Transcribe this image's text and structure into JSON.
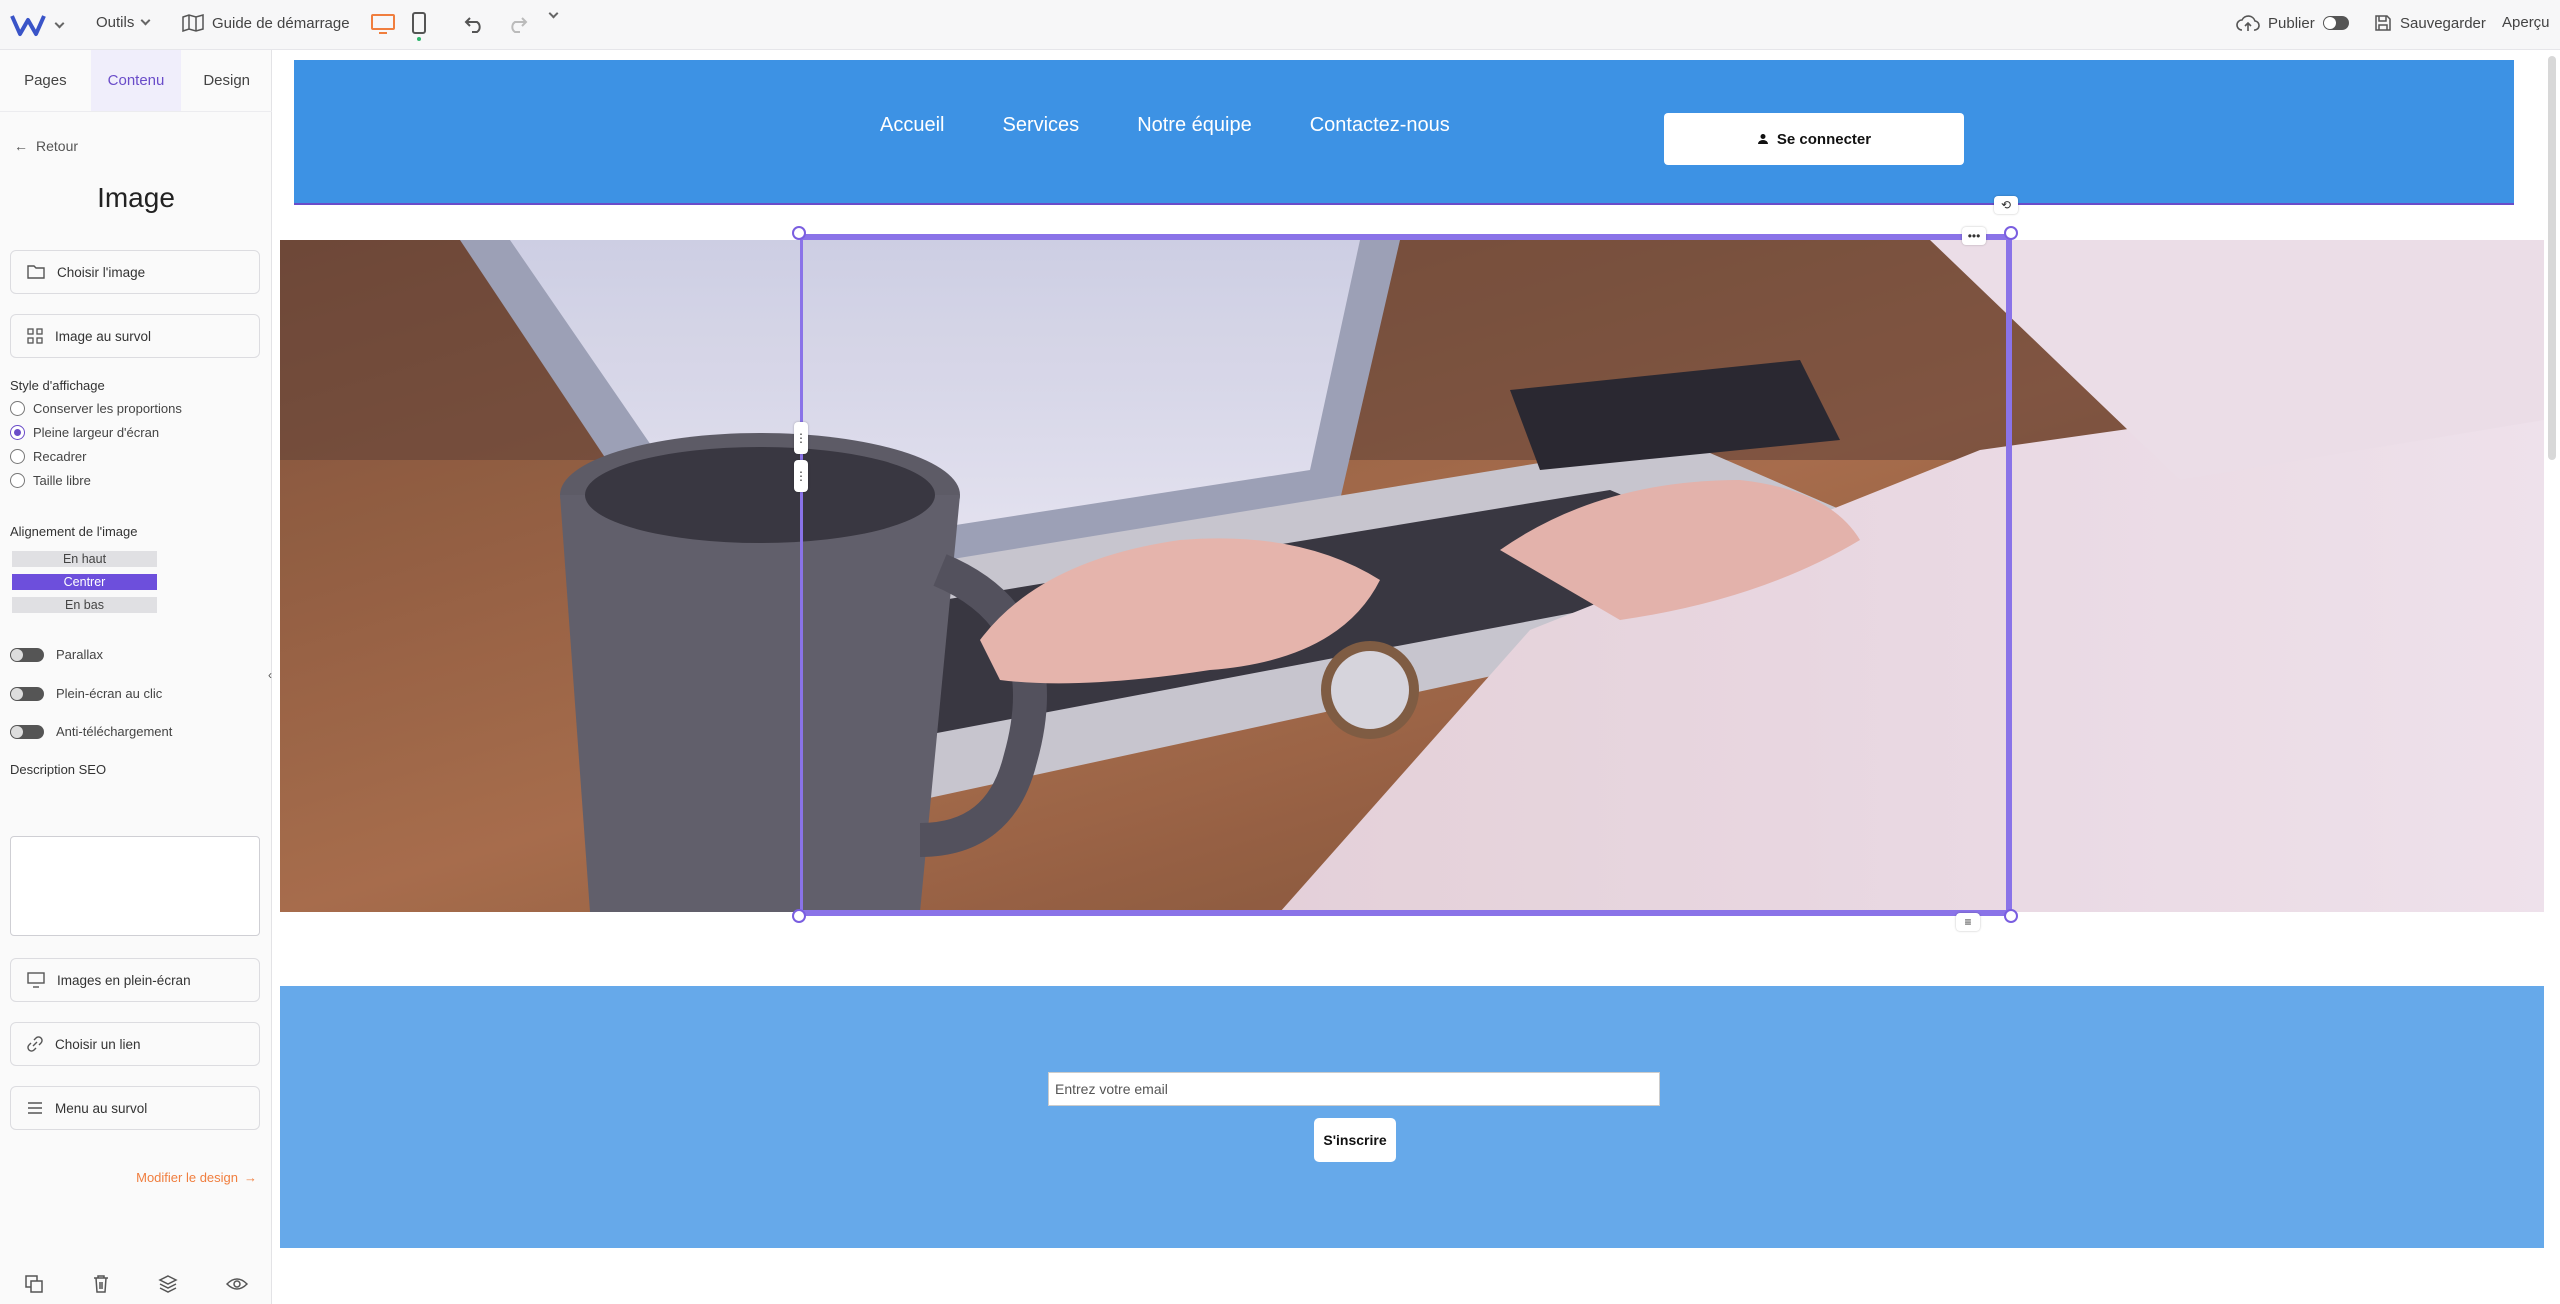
{
  "toolbar": {
    "tools_label": "Outils",
    "guide_label": "Guide de démarrage",
    "publish_label": "Publier",
    "save_label": "Sauvegarder",
    "preview_label": "Aperçu",
    "brand_color": "#3a54c8",
    "desktop_icon_color": "#f07e3e"
  },
  "sidebar": {
    "tabs": [
      {
        "label": "Pages"
      },
      {
        "label": "Contenu"
      },
      {
        "label": "Design"
      }
    ],
    "back_label": "Retour",
    "title": "Image",
    "choose_image": "Choisir l'image",
    "hover_image": "Image au survol",
    "display_style_label": "Style d'affichage",
    "display_styles": [
      {
        "label": "Conserver les proportions",
        "selected": false
      },
      {
        "label": "Pleine largeur d'écran",
        "selected": true
      },
      {
        "label": "Recadrer",
        "selected": false
      },
      {
        "label": "Taille libre",
        "selected": false
      }
    ],
    "alignment_label": "Alignement de l'image",
    "alignments": [
      {
        "label": "En haut",
        "selected": false
      },
      {
        "label": "Centrer",
        "selected": true
      },
      {
        "label": "En bas",
        "selected": false
      }
    ],
    "switches": [
      {
        "label": "Parallax",
        "on": false
      },
      {
        "label": "Plein-écran au clic",
        "on": false
      },
      {
        "label": "Anti-téléchargement",
        "on": false
      }
    ],
    "seo_label": "Description SEO",
    "fullscreen_images": "Images en plein-écran",
    "choose_link": "Choisir un lien",
    "hover_menu": "Menu au survol",
    "modify_design": "Modifier le design",
    "accent_color": "#6a4cc9"
  },
  "site": {
    "nav": [
      "Accueil",
      "Services",
      "Notre équipe",
      "Contactez-nous"
    ],
    "login_label": "Se connecter",
    "header_color": "#3d92e4",
    "newsletter_color": "#66a9ea",
    "email_placeholder": "Entrez votre email",
    "subscribe_label": "S'inscrire"
  }
}
